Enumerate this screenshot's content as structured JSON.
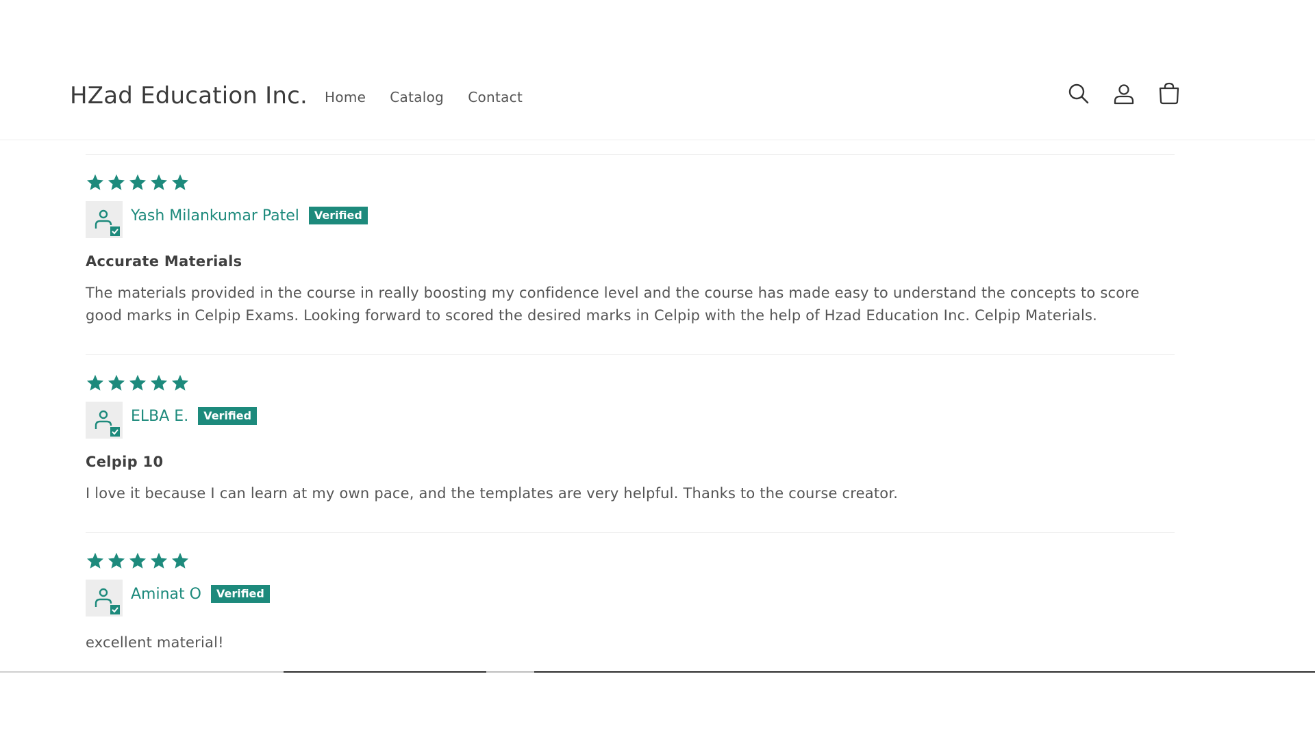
{
  "header": {
    "logo": "HZad Education Inc.",
    "nav": [
      {
        "label": "Home"
      },
      {
        "label": "Catalog"
      },
      {
        "label": "Contact"
      }
    ],
    "icons": [
      "search-icon",
      "account-icon",
      "cart-icon"
    ]
  },
  "colors": {
    "accent": "#1d8a7c",
    "text": "#4a4a4a",
    "avatar_bg": "#ededed"
  },
  "reviews": [
    {
      "rating": 5,
      "author": "Yash Milankumar Patel",
      "badge": "Verified",
      "title": "Accurate Materials",
      "body": "The materials provided in the course in really boosting my confidence level and the course has made easy to understand the concepts to score good marks in Celpip Exams. Looking forward to scored the desired marks in Celpip with the help of Hzad Education Inc. Celpip Materials."
    },
    {
      "rating": 5,
      "author": "ELBA E.",
      "badge": "Verified",
      "title": "Celpip 10",
      "body": "I love it because I can learn at my own pace, and the templates are very helpful. Thanks to the course creator."
    },
    {
      "rating": 5,
      "author": "Aminat O",
      "badge": "Verified",
      "title": "",
      "body": "excellent material!"
    }
  ]
}
